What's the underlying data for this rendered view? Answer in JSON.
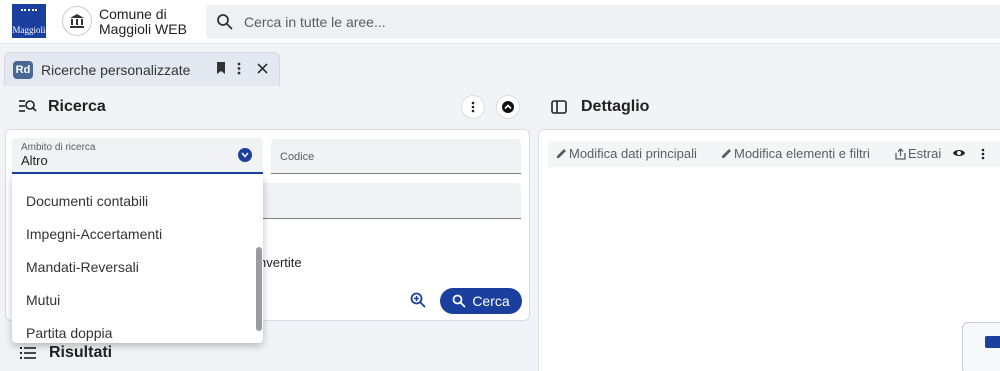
{
  "header": {
    "logo_text": "Maggioli",
    "org_name_line1": "Comune di",
    "org_name_line2": "Maggioli WEB",
    "search_placeholder": "Cerca in tutte le aree..."
  },
  "tab": {
    "icon_text": "Rd",
    "title": "Ricerche personalizzate"
  },
  "left_panel": {
    "title": "Ricerca",
    "ambito_label": "Ambito di ricerca",
    "ambito_value": "Altro",
    "codice_label": "Codice",
    "partial_option": "nvertite",
    "search_button": "Cerca"
  },
  "dropdown": {
    "options": [
      "Documenti contabili",
      "Impegni-Accertamenti",
      "Mandati-Reversali",
      "Mutui",
      "Partita doppia"
    ]
  },
  "results": {
    "title": "Risultati"
  },
  "right_panel": {
    "title": "Dettaglio",
    "toolbar": {
      "modifica_dati": "Modifica dati principali",
      "modifica_elementi": "Modifica elementi e filtri",
      "estrai": "Estrai"
    }
  },
  "colors": {
    "primary": "#1a3f9e",
    "background": "#f2f3f6"
  }
}
